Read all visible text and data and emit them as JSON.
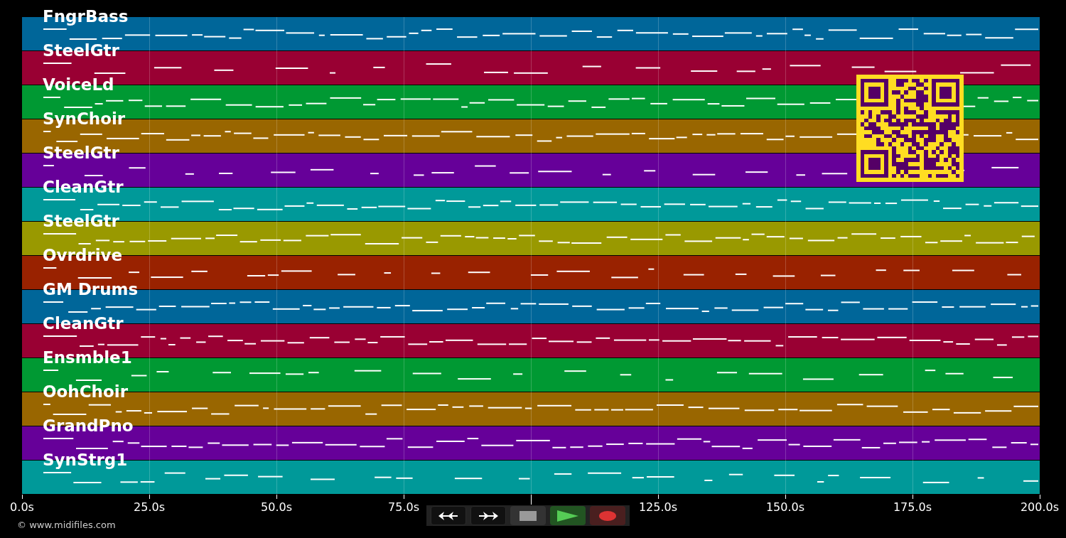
{
  "tracks": [
    {
      "name": "FngrBass",
      "color": "#006699"
    },
    {
      "name": "SteelGtr",
      "color": "#990033"
    },
    {
      "name": "VoiceLd",
      "color": "#009933"
    },
    {
      "name": "SynChoir",
      "color": "#996600"
    },
    {
      "name": "SteelGtr",
      "color": "#660099"
    },
    {
      "name": "CleanGtr",
      "color": "#009999"
    },
    {
      "name": "SteelGtr",
      "color": "#999900"
    },
    {
      "name": "Ovrdrive",
      "color": "#992200"
    },
    {
      "name": "GM Drums",
      "color": "#006699"
    },
    {
      "name": "CleanGtr",
      "color": "#990033"
    },
    {
      "name": "Ensmble1",
      "color": "#009933"
    },
    {
      "name": "OohChoir",
      "color": "#996600"
    },
    {
      "name": "GrandPno",
      "color": "#660099"
    },
    {
      "name": "SynStrg1",
      "color": "#009999"
    }
  ],
  "axis_ticks": [
    {
      "label": "0.0s"
    },
    {
      "label": "25.0s"
    },
    {
      "label": "50.0s"
    },
    {
      "label": "75.0s"
    },
    {
      "kind": "unlabeled"
    },
    {
      "label": "125.0s"
    },
    {
      "label": "150.0s"
    },
    {
      "label": "175.0s"
    },
    {
      "label": "200.0s"
    }
  ],
  "controls": [
    {
      "kind": "rewind"
    },
    {
      "kind": "forward"
    },
    {
      "kind": "stop"
    },
    {
      "kind": "play"
    },
    {
      "kind": "record"
    }
  ],
  "credit": "© www.midifiles.com"
}
